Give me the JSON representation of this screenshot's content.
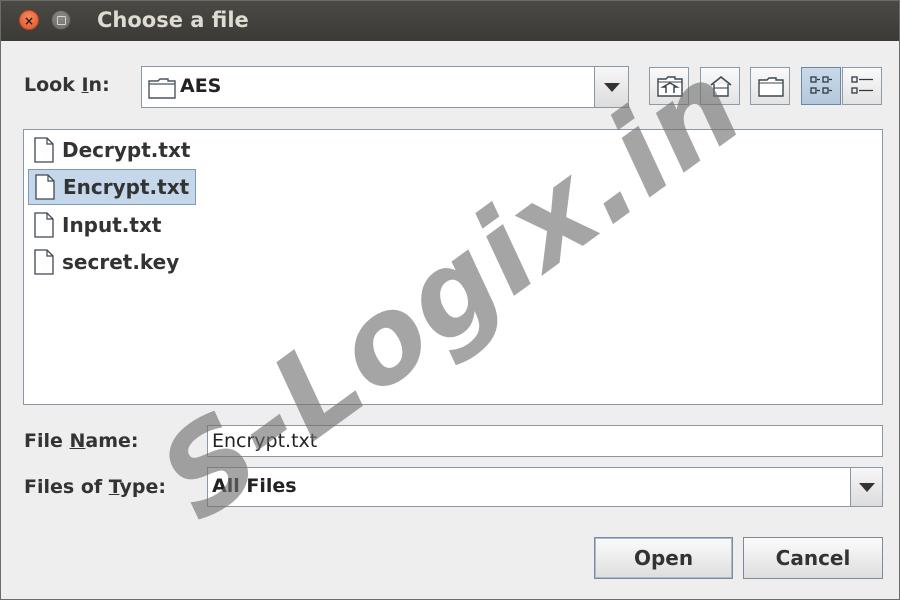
{
  "window": {
    "title": "Choose a file",
    "close_glyph": "×"
  },
  "look_in": {
    "label_pre": "Look ",
    "label_mnemonic": "I",
    "label_post": "n:",
    "value": "AES",
    "icon": "folder-icon"
  },
  "toolbar": {
    "buttons": [
      {
        "name": "up-one-level-button",
        "icon": "folder-up-icon"
      },
      {
        "name": "home-button",
        "icon": "home-icon"
      },
      {
        "name": "new-folder-button",
        "icon": "new-folder-icon"
      },
      {
        "name": "list-view-button",
        "icon": "list-view-icon",
        "selected": true
      },
      {
        "name": "details-view-button",
        "icon": "details-view-icon",
        "selected": false
      }
    ]
  },
  "files": [
    {
      "name": "Decrypt.txt",
      "selected": false,
      "icon": "file-icon"
    },
    {
      "name": "Encrypt.txt",
      "selected": true,
      "icon": "file-icon"
    },
    {
      "name": "Input.txt",
      "selected": false,
      "icon": "file-icon"
    },
    {
      "name": "secret.key",
      "selected": false,
      "icon": "file-icon"
    }
  ],
  "file_name": {
    "label_pre": "File ",
    "label_mnemonic": "N",
    "label_post": "ame:",
    "value": "Encrypt.txt"
  },
  "file_type": {
    "label_pre": "Files of ",
    "label_mnemonic": "T",
    "label_post": "ype:",
    "value": "All Files"
  },
  "buttons": {
    "open": "Open",
    "cancel": "Cancel"
  },
  "watermark": {
    "text": "S-Logix.in"
  },
  "colors": {
    "titlebar": "#3c3b37",
    "close_button": "#e95420",
    "selection": "#c5d7ea",
    "background": "#eeeeee"
  }
}
